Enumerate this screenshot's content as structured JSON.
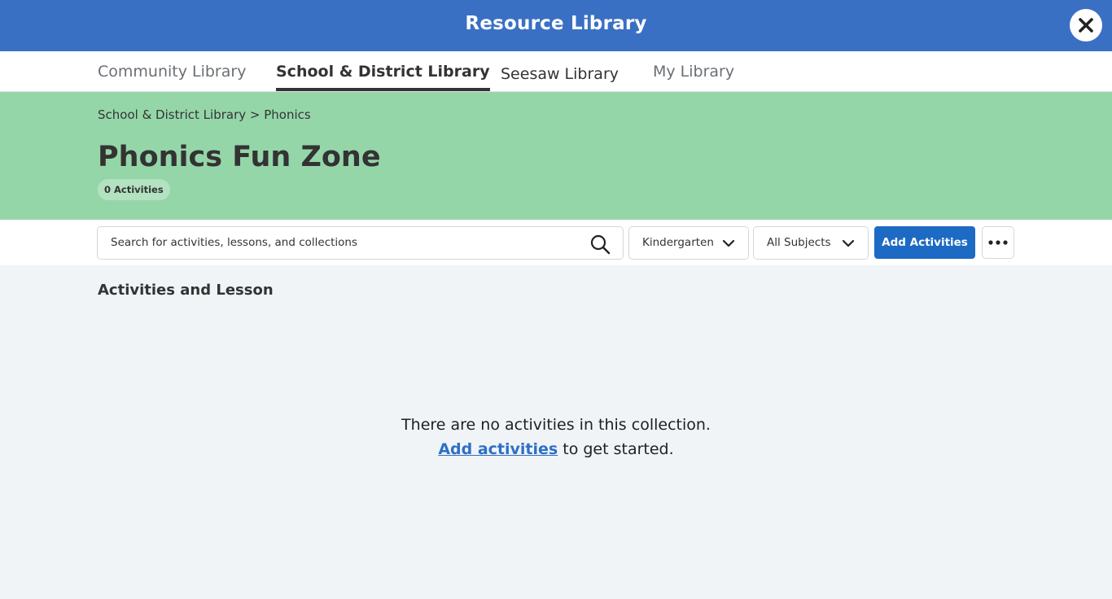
{
  "header": {
    "title": "Resource Library",
    "close_icon": "close-icon"
  },
  "tabs": [
    {
      "label": "Community Library"
    },
    {
      "label": "School & District Library",
      "active": true
    },
    {
      "label": "Seesaw Library"
    },
    {
      "label": "My Library"
    }
  ],
  "hero": {
    "background": "#95d6a9",
    "breadcrumb": "School & District Library > Phonics",
    "title": "Phonics Fun Zone",
    "count": "0 Activities"
  },
  "toolbar": {
    "search_placeholder": "Search for activities, lessons, and collections",
    "grade_value": "Kindergarten",
    "subject_value": "All Subjects",
    "add_label": "Add Activities",
    "accent": "#1d6ac4"
  },
  "content": {
    "section_title": "Activities and Lesson",
    "empty_message": "There are no activities in this collection.",
    "empty_link": "Add activities",
    "empty_suffix": " to get started."
  }
}
